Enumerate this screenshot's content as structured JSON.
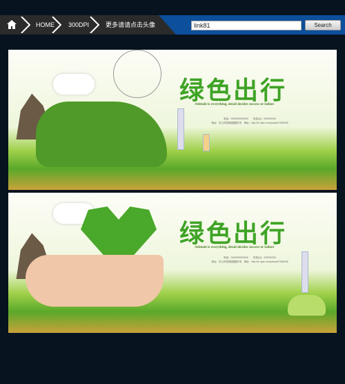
{
  "nav": {
    "home_icon": "home-icon",
    "crumbs": [
      "HOME",
      "300DPI",
      "更多请请点击头像"
    ]
  },
  "search": {
    "value": "link81",
    "button": "Search"
  },
  "colors": {
    "background": "#07131f",
    "nav_blue": "#0c4f9a",
    "breadcrumb_bg": "#2b2b2b",
    "title_green": "#3fa326"
  },
  "posters": [
    {
      "title": "绿色出行",
      "subtitle": "Attitude is everything, detail decides success or failure",
      "phone": "电话：0000000000000　　传真(Q)：000000000",
      "address": "地址：中山市招商园园园1号　网址：http://fc.nipic.com/people/7656246"
    },
    {
      "title": "绿色出行",
      "subtitle": "Attitude is everything, detail decides success or failure",
      "phone": "电话：0000000000000　　传真(Q)：000000000",
      "address": "地址：中山市招商园园园1号　网址：http://fc.nipic.com/people/7656246"
    }
  ]
}
